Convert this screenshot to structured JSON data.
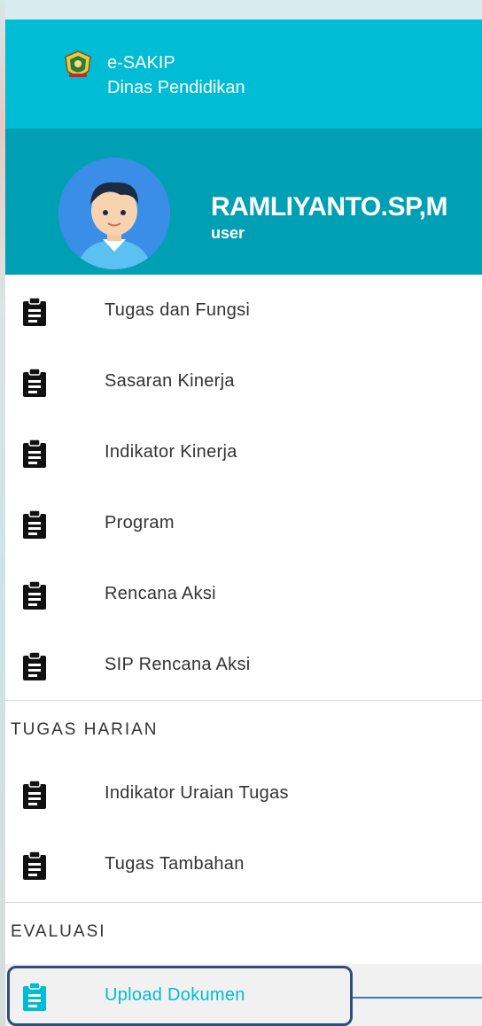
{
  "brand": {
    "app_name": "e-SAKIP",
    "org_name": "Dinas Pendidikan",
    "logo_icon": "government-crest-icon",
    "color": "#00bcd4"
  },
  "user": {
    "name": "RAMLIYANTO.SP,M",
    "role": "user",
    "avatar_icon": "avatar-boy-icon",
    "panel_color": "#00a0b4"
  },
  "menu": {
    "items": [
      {
        "label": "Tugas dan Fungsi",
        "icon": "clipboard-icon"
      },
      {
        "label": "Sasaran Kinerja",
        "icon": "clipboard-icon"
      },
      {
        "label": "Indikator Kinerja",
        "icon": "clipboard-icon"
      },
      {
        "label": "Program",
        "icon": "clipboard-icon"
      },
      {
        "label": "Rencana Aksi",
        "icon": "clipboard-icon"
      },
      {
        "label": "SIP Rencana Aksi",
        "icon": "clipboard-icon"
      }
    ],
    "sections": [
      {
        "header": "TUGAS HARIAN",
        "items": [
          {
            "label": "Indikator Uraian Tugas",
            "icon": "clipboard-icon"
          },
          {
            "label": "Tugas Tambahan",
            "icon": "clipboard-icon"
          }
        ]
      },
      {
        "header": "EVALUASI",
        "items": [
          {
            "label": "Upload Dokumen",
            "icon": "clipboard-icon",
            "active": true
          }
        ]
      }
    ],
    "active_color": "#00bcd4",
    "highlight_border_color": "#2f4f7a"
  }
}
